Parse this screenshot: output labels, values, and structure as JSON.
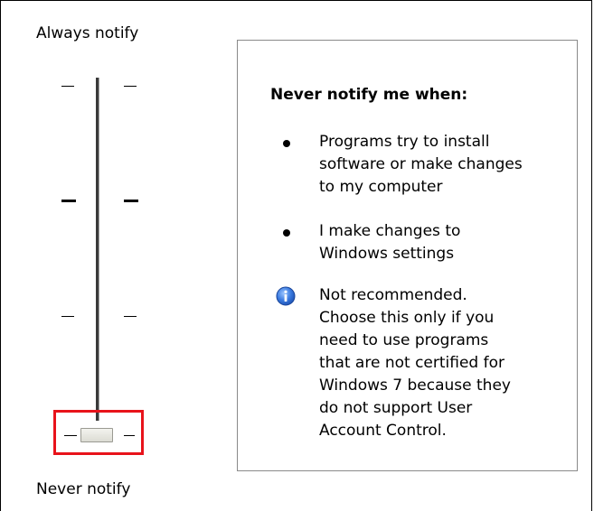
{
  "slider": {
    "top_label": "Always notify",
    "bottom_label": "Never notify",
    "level": 0,
    "levels": 4
  },
  "panel": {
    "title": "Never notify me when:",
    "bullets": [
      "Programs try to install\nsoftware or make changes\nto my computer",
      "I make changes to\nWindows settings"
    ],
    "info": {
      "icon": "info-icon",
      "text": "Not recommended.\nChoose this only if you\nneed to use programs\nthat are not certified for\nWindows 7 because they\ndo not support User\nAccount Control."
    }
  },
  "colors": {
    "highlight": "#e8131b",
    "info_blue": "#2f6fd3"
  }
}
